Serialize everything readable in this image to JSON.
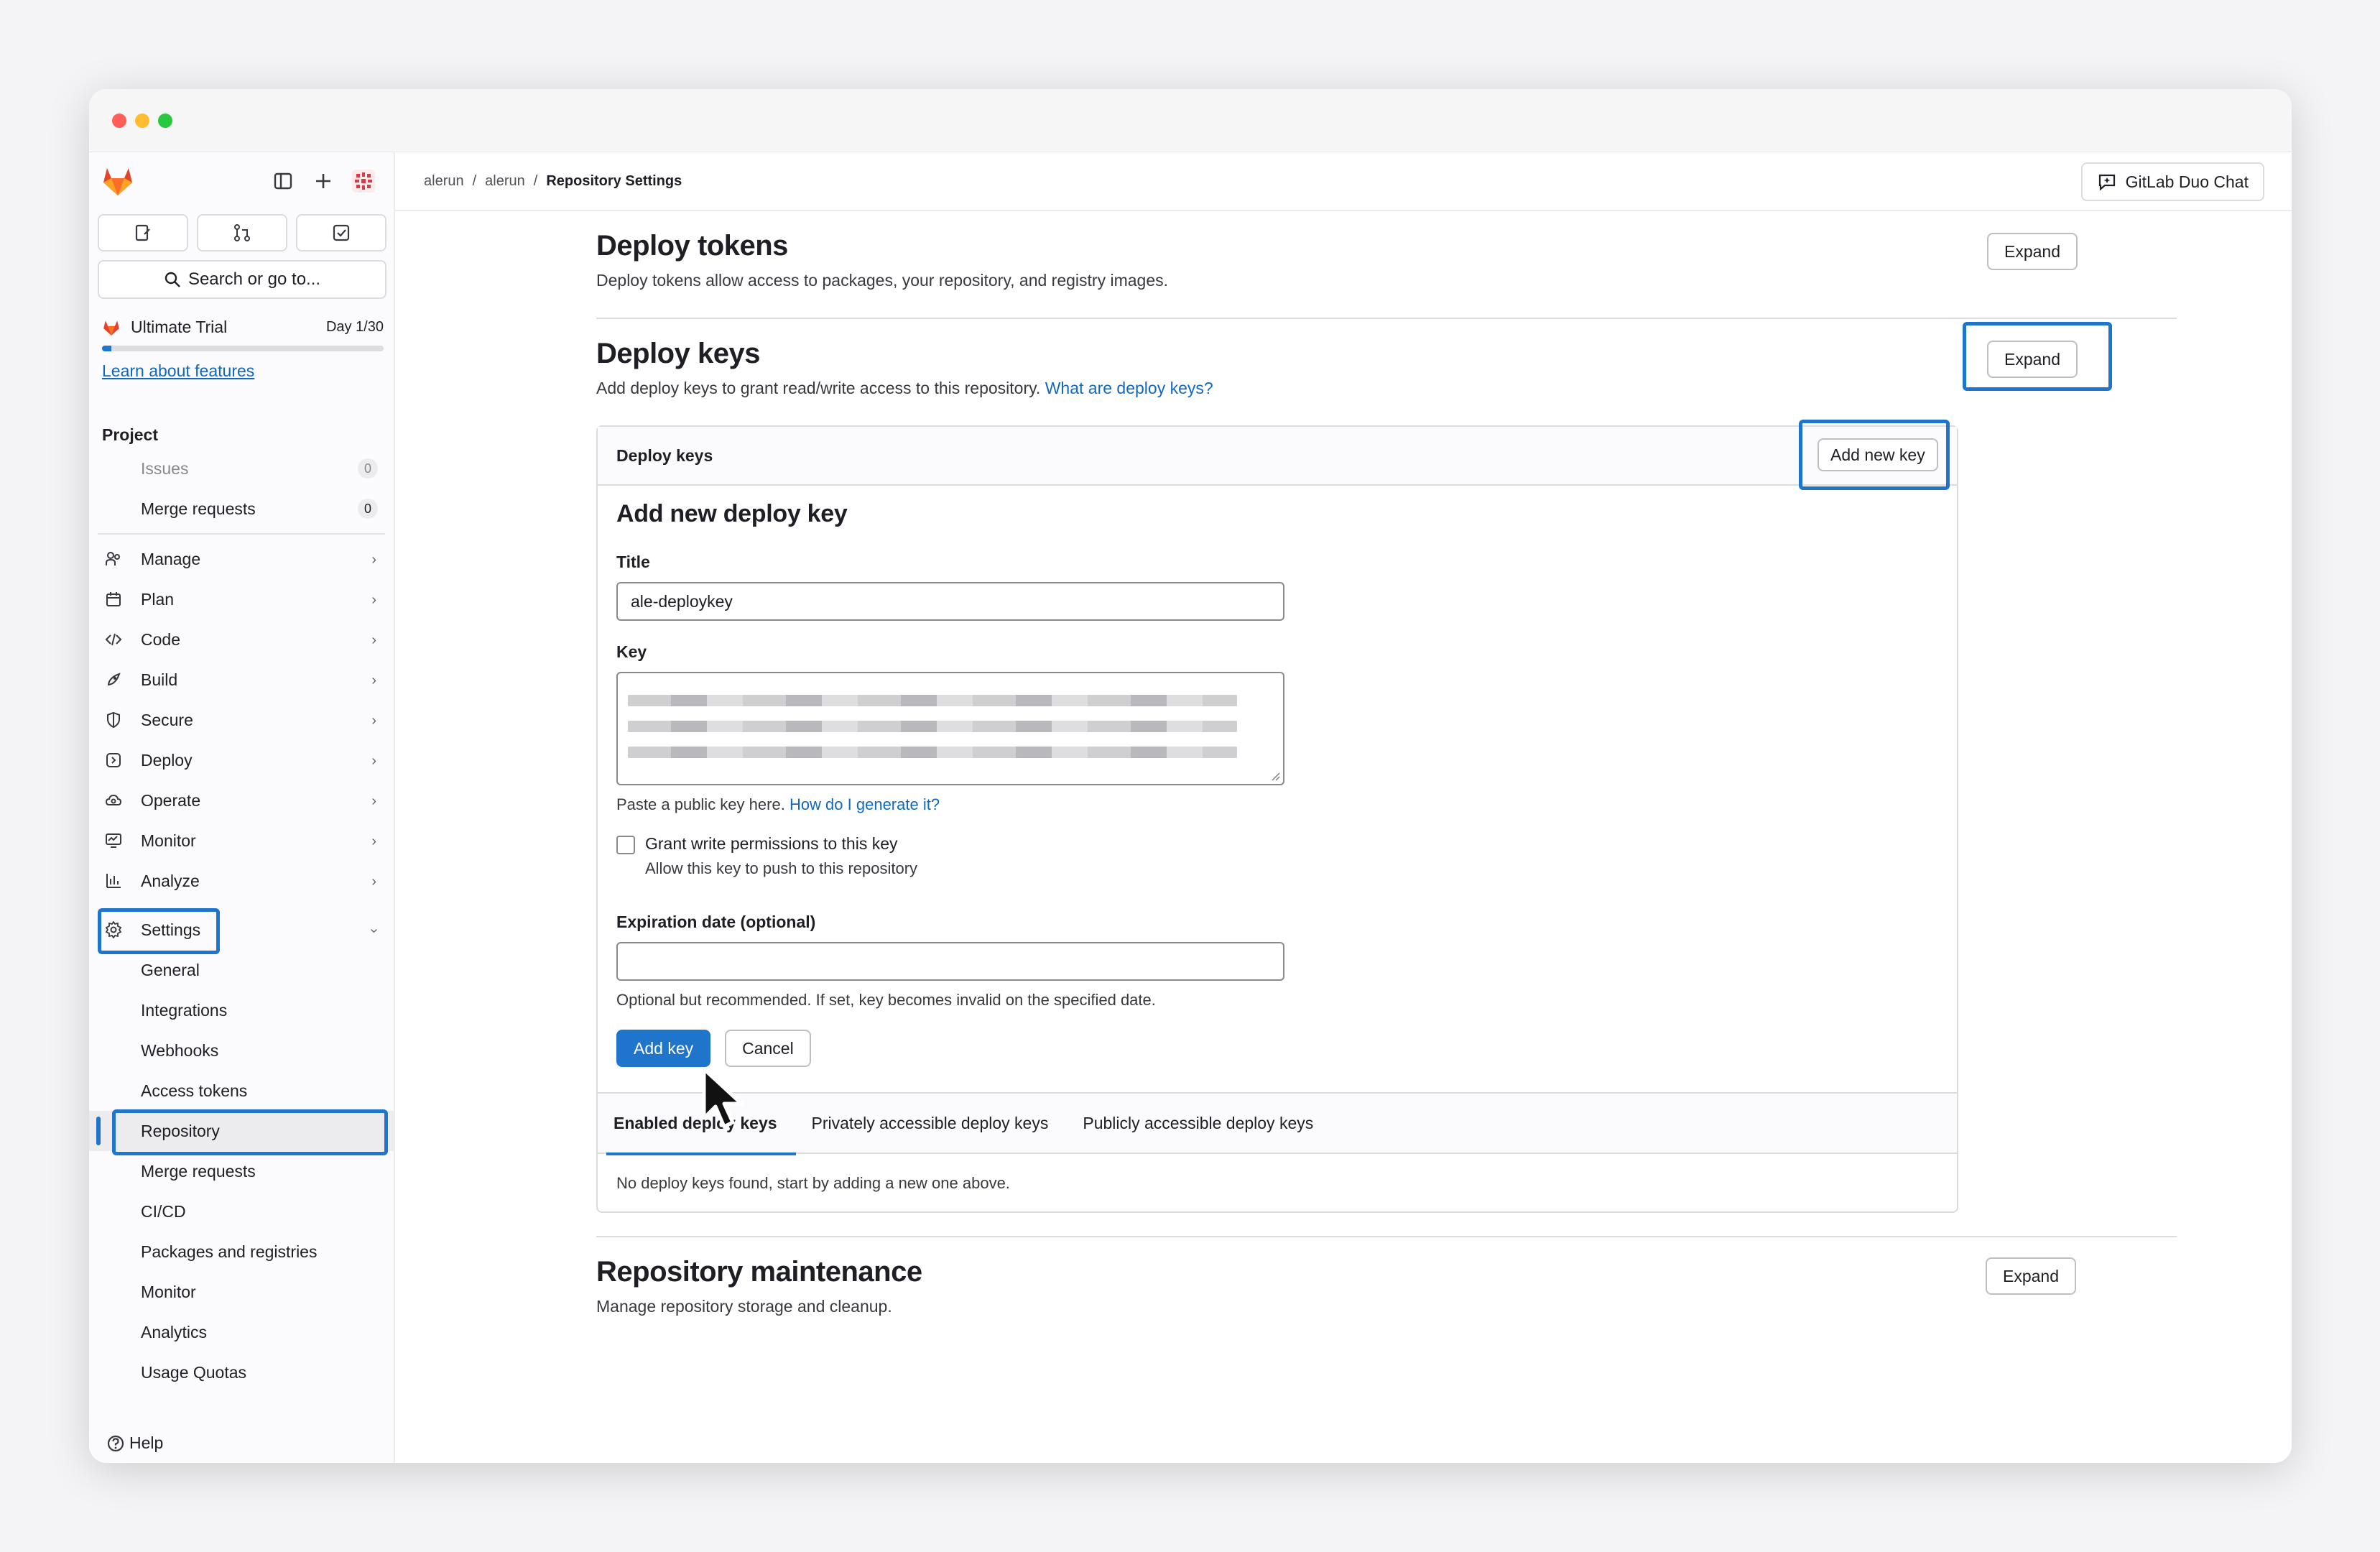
{
  "window": {
    "title": ""
  },
  "sidebar": {
    "search_label": "Search or go to...",
    "trial": {
      "name": "Ultimate Trial",
      "day": "Day 1/30",
      "progress": 0.033,
      "learn_link": "Learn about features"
    },
    "section_label": "Project",
    "pinned": [
      {
        "label": "Issues",
        "count": "0"
      },
      {
        "label": "Merge requests",
        "count": "0"
      }
    ],
    "groups": [
      {
        "label": "Manage"
      },
      {
        "label": "Plan"
      },
      {
        "label": "Code"
      },
      {
        "label": "Build"
      },
      {
        "label": "Secure"
      },
      {
        "label": "Deploy"
      },
      {
        "label": "Operate"
      },
      {
        "label": "Monitor"
      },
      {
        "label": "Analyze"
      }
    ],
    "settings": {
      "label": "Settings",
      "items": [
        "General",
        "Integrations",
        "Webhooks",
        "Access tokens",
        "Repository",
        "Merge requests",
        "CI/CD",
        "Packages and registries",
        "Monitor",
        "Analytics",
        "Usage Quotas"
      ],
      "active_item": "Repository"
    },
    "help_label": "Help"
  },
  "header": {
    "breadcrumb": [
      "alerun",
      "alerun",
      "Repository Settings"
    ],
    "duo_chat_label": "GitLab Duo Chat"
  },
  "deploy_tokens": {
    "title": "Deploy tokens",
    "description": "Deploy tokens allow access to packages, your repository, and registry images.",
    "expand_label": "Expand"
  },
  "deploy_keys": {
    "title": "Deploy keys",
    "description": "Add deploy keys to grant read/write access to this repository.",
    "help_link": "What are deploy keys?",
    "expand_label": "Expand",
    "panel_title": "Deploy keys",
    "add_new_key_label": "Add new key",
    "form": {
      "heading": "Add new deploy key",
      "title_label": "Title",
      "title_value": "ale-deploykey",
      "key_label": "Key",
      "key_help": "Paste a public key here.",
      "key_help_link": "How do I generate it?",
      "write_permission_label": "Grant write permissions to this key",
      "write_permission_help": "Allow this key to push to this repository",
      "write_permission_checked": false,
      "expiration_label": "Expiration date (optional)",
      "expiration_value": "",
      "expiration_help": "Optional but recommended. If set, key becomes invalid on the specified date.",
      "add_key_label": "Add key",
      "cancel_label": "Cancel"
    },
    "tabs": [
      {
        "label": "Enabled deploy keys",
        "active": true
      },
      {
        "label": "Privately accessible deploy keys",
        "active": false
      },
      {
        "label": "Publicly accessible deploy keys",
        "active": false
      }
    ],
    "empty_message": "No deploy keys found, start by adding a new one above."
  },
  "repository_maintenance": {
    "title": "Repository maintenance",
    "description": "Manage repository storage and cleanup.",
    "expand_label": "Expand"
  },
  "colors": {
    "accent": "#1f75cb",
    "link": "#1068bf",
    "brand_orange": "#fc6d26",
    "brand_red": "#e24329"
  }
}
